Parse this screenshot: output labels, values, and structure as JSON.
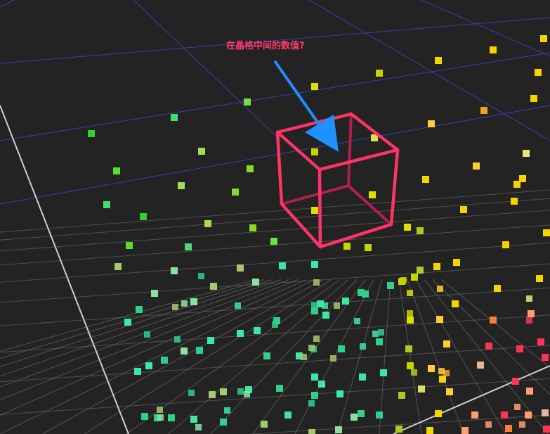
{
  "annotation": {
    "text": "在晶格中间的数值?",
    "color": "#ff3d6b"
  },
  "colors": {
    "background": "#232323",
    "far_grid": "#3b3fb0",
    "floor_grid": "#7d7d7d",
    "axis_line": "#c8c8c8",
    "cube_outline": "#ff3366",
    "arrow": "#1e90ff"
  },
  "icons": {
    "arrow": "pointer-arrow-icon",
    "cube": "lattice-cell-cube-icon"
  }
}
